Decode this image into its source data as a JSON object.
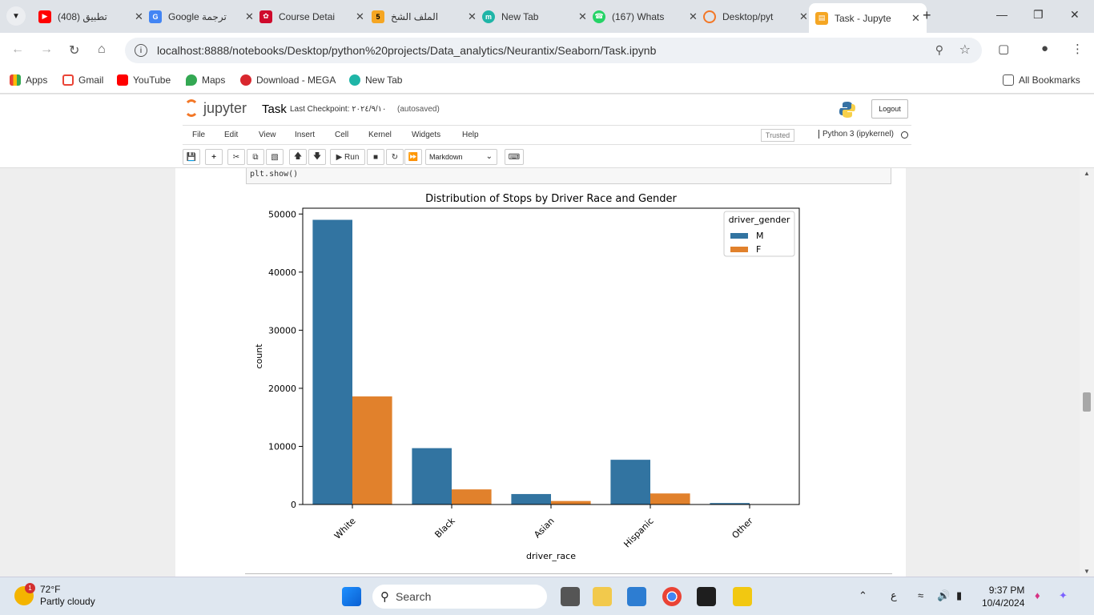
{
  "browser": {
    "tabs": [
      {
        "title": "(408) تطبيق",
        "favicon": "youtube-icon"
      },
      {
        "title": "Google ترجمة",
        "favicon": "google-translate-icon"
      },
      {
        "title": "Course Detai",
        "favicon": "huawei-icon"
      },
      {
        "title": "الملف الشخ",
        "favicon": "profile-icon"
      },
      {
        "title": "New Tab",
        "favicon": "new-tab-icon"
      },
      {
        "title": "(167) Whats",
        "favicon": "whatsapp-icon"
      },
      {
        "title": "Desktop/pyt",
        "favicon": "jupyter-icon"
      },
      {
        "title": "Task - Jupyte",
        "favicon": "notebook-icon",
        "active": true
      }
    ],
    "url": "localhost:8888/notebooks/Desktop/python%20projects/Data_analytics/Neurantix/Seaborn/Task.ipynb",
    "bookmarks": [
      {
        "label": "Apps",
        "icon": "apps-grid-icon"
      },
      {
        "label": "Gmail",
        "icon": "gmail-icon"
      },
      {
        "label": "YouTube",
        "icon": "youtube-icon"
      },
      {
        "label": "Maps",
        "icon": "maps-icon"
      },
      {
        "label": "Download - MEGA",
        "icon": "mega-icon"
      },
      {
        "label": "New Tab",
        "icon": "new-tab-icon"
      }
    ],
    "all_bookmarks": "All Bookmarks"
  },
  "jupyter": {
    "logo": "jupyter",
    "notebook_title": "Task",
    "checkpoint": "Last Checkpoint: ٢٠٢٤/٩/١٠",
    "autosaved": "(autosaved)",
    "logout": "Logout",
    "menu": [
      "File",
      "Edit",
      "View",
      "Insert",
      "Cell",
      "Kernel",
      "Widgets",
      "Help"
    ],
    "trusted": "Trusted",
    "kernel": "Python 3 (ipykernel)",
    "run_label": "Run",
    "cell_type": "Markdown",
    "code_line": "plt.show()"
  },
  "chart_data": {
    "type": "bar",
    "title": "Distribution of Stops by Driver Race and Gender",
    "xlabel": "driver_race",
    "ylabel": "count",
    "categories": [
      "White",
      "Black",
      "Asian",
      "Hispanic",
      "Other"
    ],
    "series": [
      {
        "name": "M",
        "color": "#3274a1",
        "values": [
          49000,
          9700,
          1800,
          7700,
          250
        ]
      },
      {
        "name": "F",
        "color": "#e1812c",
        "values": [
          18600,
          2600,
          600,
          1900,
          50
        ]
      }
    ],
    "ylim": [
      0,
      51000
    ],
    "yticks": [
      0,
      10000,
      20000,
      30000,
      40000,
      50000
    ],
    "legend_title": "driver_gender",
    "legend_position": "top-right",
    "grid": false
  },
  "taskbar": {
    "temperature": "72°F",
    "weather": "Partly cloudy",
    "weather_badge": "1",
    "search": "Search",
    "lang": "ع",
    "time": "9:37 PM",
    "date": "10/4/2024"
  }
}
